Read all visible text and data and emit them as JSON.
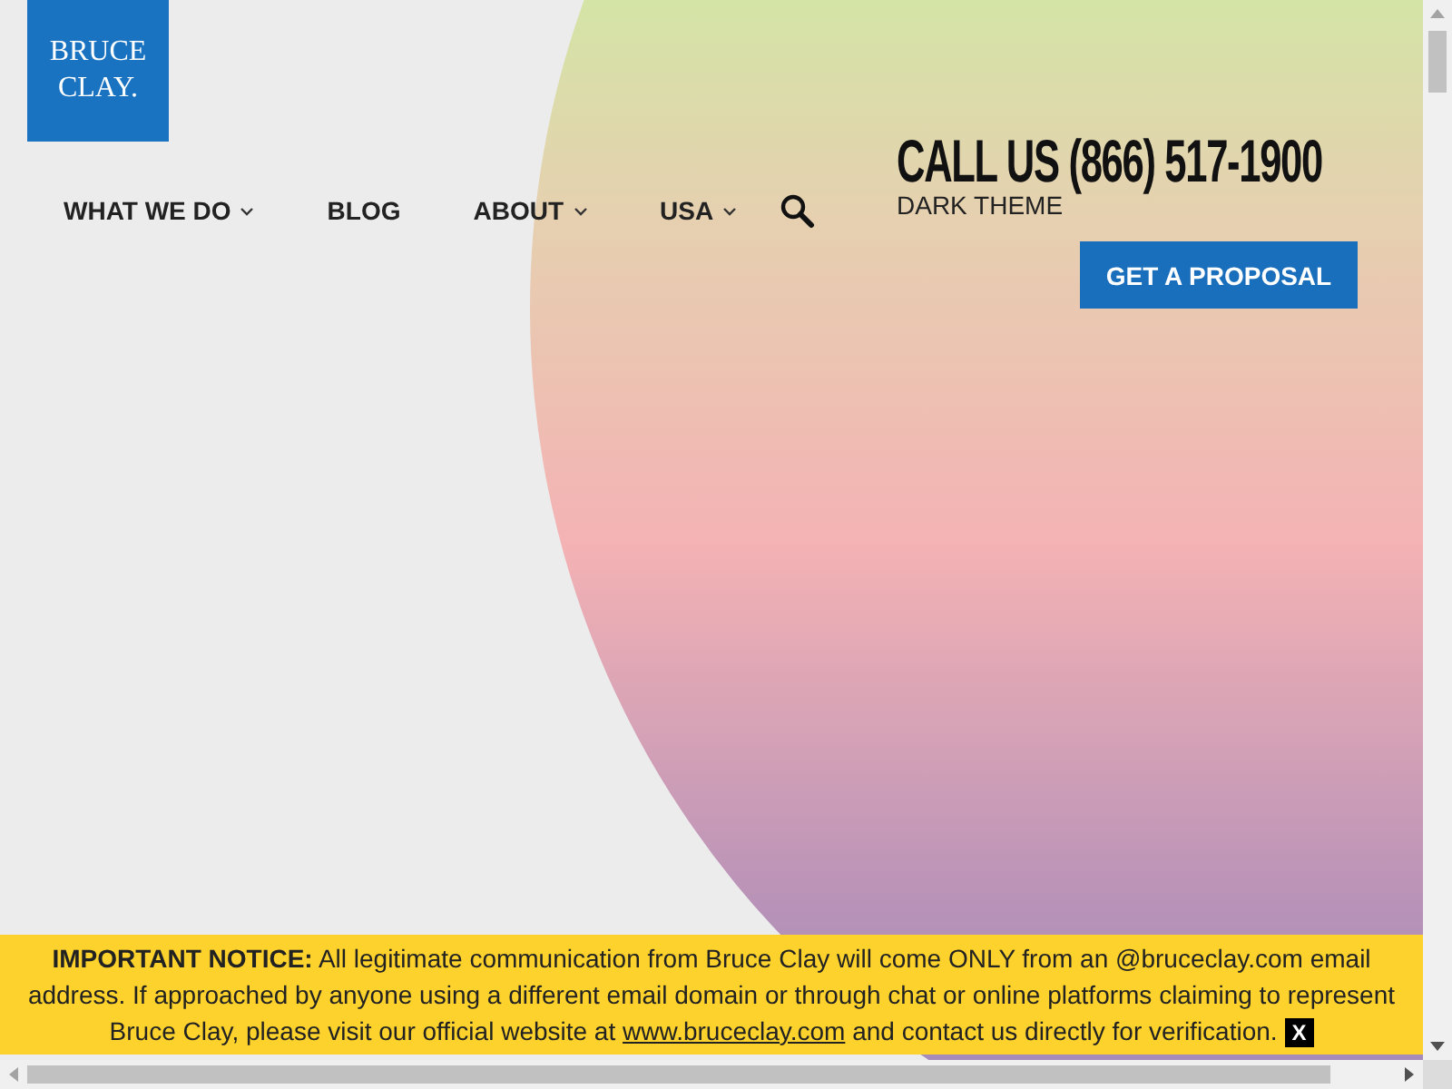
{
  "logo": {
    "lines": [
      "BRUCE",
      "CLAY."
    ]
  },
  "nav": [
    {
      "label": "WHAT WE DO",
      "has_menu": true
    },
    {
      "label": "BLOG",
      "has_menu": false
    },
    {
      "label": "ABOUT",
      "has_menu": true
    },
    {
      "label": "USA",
      "has_menu": true
    }
  ],
  "phone": "CALL US (866) 517-1900",
  "theme_toggle": "DARK THEME",
  "cta_button": "GET A PROPOSAL",
  "notice": {
    "text": "**IMPORTANT NOTICE:** All legitimate communication from Bruce Clay will come ONLY from an @bruceclay.com email address. If approached by anyone using a different email domain or through chat or online platforms claiming to represent Bruce Clay, please visit our official website at",
    "link": "www.bruceclay.com",
    "text_after": "and contact us directly for verification.",
    "close": "X"
  }
}
